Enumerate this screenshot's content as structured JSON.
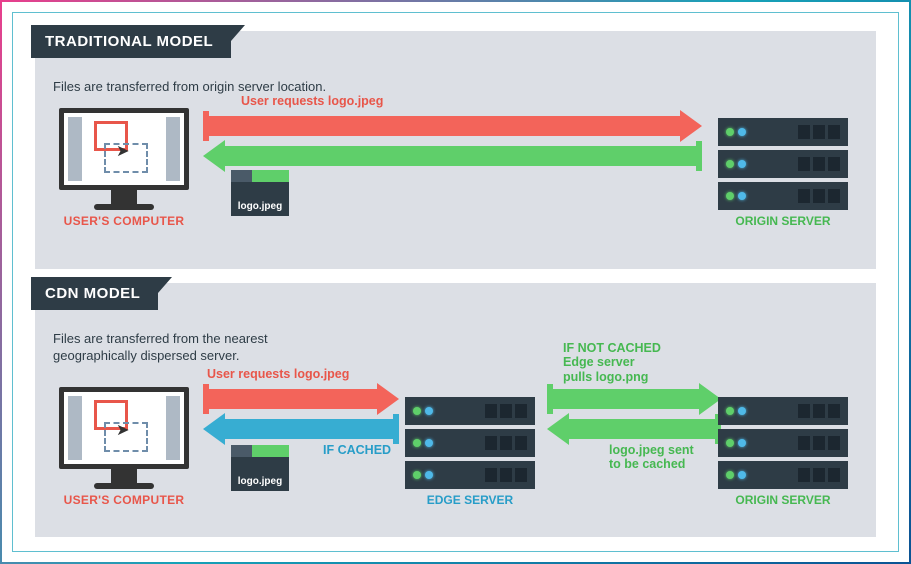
{
  "traditional": {
    "title": "TRADITIONAL MODEL",
    "subtitle": "Files are transferred from origin server location.",
    "request_label": "User requests logo.jpeg",
    "file_label": "logo.jpeg",
    "user_label": "USER'S COMPUTER",
    "origin_label": "ORIGIN SERVER"
  },
  "cdn": {
    "title": "CDN MODEL",
    "subtitle": "Files are transferred from the nearest geographically dispersed server.",
    "request_label": "User requests logo.jpeg",
    "cached_label": "IF CACHED",
    "not_cached_line1": "IF NOT CACHED",
    "not_cached_line2": "Edge server",
    "not_cached_line3": "pulls logo.png",
    "cache_return_line1": "logo.jpeg sent",
    "cache_return_line2": "to be cached",
    "file_label": "logo.jpeg",
    "user_label": "USER'S COMPUTER",
    "edge_label": "EDGE SERVER",
    "origin_label": "ORIGIN SERVER"
  },
  "colors": {
    "red": "#f3645a",
    "green": "#5fcf6a",
    "blue": "#37add2",
    "dark": "#2e3c46"
  }
}
